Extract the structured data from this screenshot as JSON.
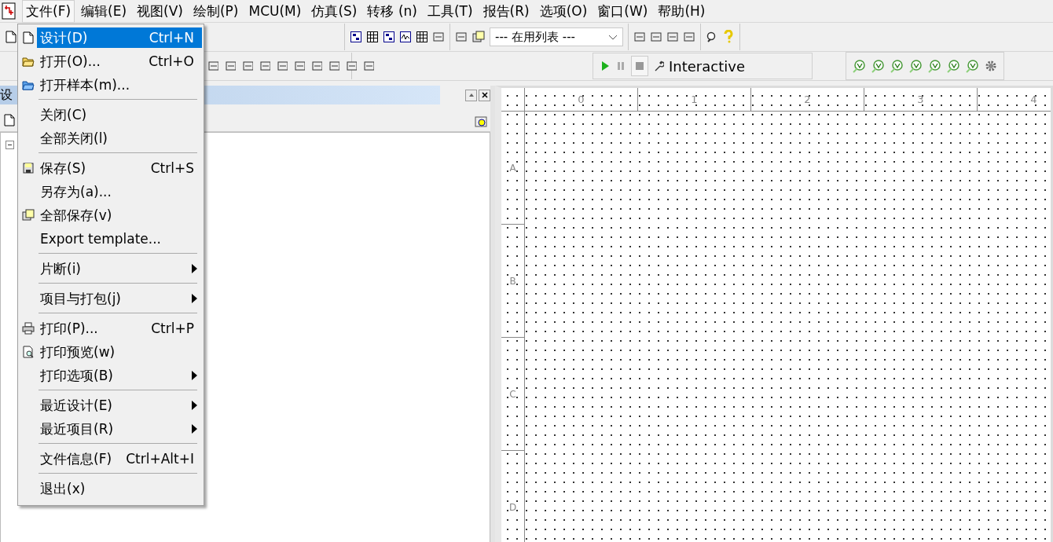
{
  "menubar": [
    {
      "label": "文件(F)",
      "selected": true
    },
    {
      "label": "编辑(E)",
      "selected": false
    },
    {
      "label": "视图(V)",
      "selected": false
    },
    {
      "label": "绘制(P)",
      "selected": false
    },
    {
      "label": "MCU(M)",
      "selected": false
    },
    {
      "label": "仿真(S)",
      "selected": false
    },
    {
      "label": "转移 (n)",
      "selected": false
    },
    {
      "label": "工具(T)",
      "selected": false
    },
    {
      "label": "报告(R)",
      "selected": false
    },
    {
      "label": "选项(O)",
      "selected": false
    },
    {
      "label": "窗口(W)",
      "selected": false
    },
    {
      "label": "帮助(H)",
      "selected": false
    }
  ],
  "toolbar": {
    "list_dropdown": "--- 在用列表 ---",
    "simulation_mode": "Interactive"
  },
  "design_panel": {
    "title": "设"
  },
  "file_menu": [
    {
      "kind": "command",
      "label": "设计(D)",
      "shortcut": "Ctrl+N",
      "selected": true
    },
    {
      "kind": "command",
      "label": "打开(O)...",
      "shortcut": "Ctrl+O",
      "selected": false
    },
    {
      "kind": "command",
      "label": "打开样本(m)...",
      "selected": false
    },
    {
      "kind": "separator"
    },
    {
      "kind": "command",
      "label": "关闭(C)",
      "selected": false
    },
    {
      "kind": "command",
      "label": "全部关闭(l)",
      "selected": false
    },
    {
      "kind": "separator"
    },
    {
      "kind": "command",
      "label": "保存(S)",
      "shortcut": "Ctrl+S",
      "selected": false
    },
    {
      "kind": "command",
      "label": "另存为(a)...",
      "selected": false
    },
    {
      "kind": "command",
      "label": "全部保存(v)",
      "selected": false
    },
    {
      "kind": "command",
      "label": "Export template...",
      "selected": false
    },
    {
      "kind": "separator"
    },
    {
      "kind": "submenu",
      "label": "片断(i)",
      "selected": false
    },
    {
      "kind": "separator"
    },
    {
      "kind": "submenu",
      "label": "项目与打包(j)",
      "selected": false
    },
    {
      "kind": "separator"
    },
    {
      "kind": "command",
      "label": "打印(P)...",
      "shortcut": "Ctrl+P",
      "selected": false
    },
    {
      "kind": "command",
      "label": "打印预览(w)",
      "selected": false
    },
    {
      "kind": "submenu",
      "label": "打印选项(B)",
      "selected": false
    },
    {
      "kind": "separator"
    },
    {
      "kind": "submenu",
      "label": "最近设计(E)",
      "selected": false
    },
    {
      "kind": "submenu",
      "label": "最近项目(R)",
      "selected": false
    },
    {
      "kind": "separator"
    },
    {
      "kind": "command",
      "label": "文件信息(F)",
      "shortcut": "Ctrl+Alt+I",
      "selected": false
    },
    {
      "kind": "separator"
    },
    {
      "kind": "command",
      "label": "退出(x)",
      "selected": false
    }
  ],
  "canvas": {
    "columns": [
      "0",
      "1",
      "2",
      "3",
      "4"
    ],
    "rows": [
      "A",
      "B",
      "C",
      "D"
    ]
  }
}
